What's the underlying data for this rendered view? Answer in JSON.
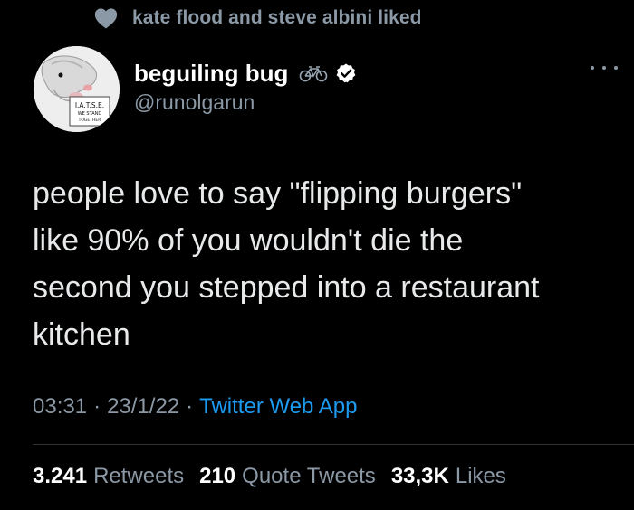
{
  "social_context": {
    "icon": "heart-icon",
    "text": "kate flood and steve albini liked"
  },
  "author": {
    "display_name": "beguiling bug",
    "handle": "@runolgarun",
    "name_icons": [
      "bicycle-icon",
      "verified-badge-icon"
    ],
    "avatar_sign_text": [
      "I.A.T.S.E.",
      "WE STAND",
      "TOGETHER"
    ]
  },
  "tweet": {
    "text": "people love to say \"flipping burgers\"\nlike 90% of you wouldn't die the\nsecond you stepped into a restaurant\nkitchen"
  },
  "meta": {
    "time": "03:31",
    "separator": "·",
    "date": "23/1/22",
    "source": "Twitter Web App"
  },
  "stats": {
    "retweets_count": "3.241",
    "retweets_label": "Retweets",
    "quotes_count": "210",
    "quotes_label": "Quote Tweets",
    "likes_count": "33,3K",
    "likes_label": "Likes"
  },
  "colors": {
    "background": "#000000",
    "primary_text": "#e7e9ea",
    "secondary_text": "#8b98a5",
    "link": "#1d9bf0",
    "divider": "#2f3336"
  }
}
